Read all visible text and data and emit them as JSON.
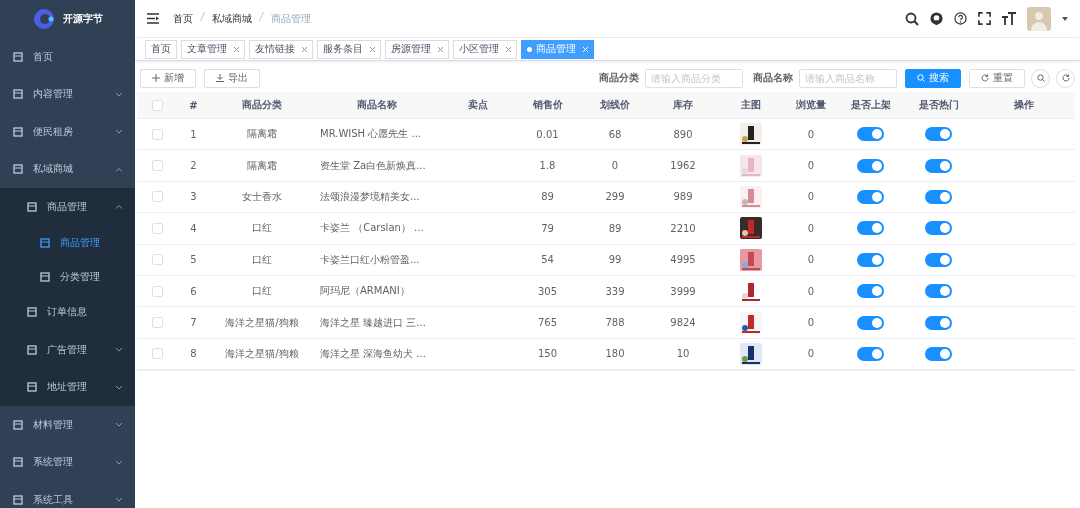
{
  "brand": {
    "name": "开源字节"
  },
  "sidebar": {
    "items": [
      {
        "label": "首页",
        "selected": false
      },
      {
        "label": "内容管理",
        "selected": false,
        "expanded": false
      },
      {
        "label": "便民租房",
        "selected": false,
        "expanded": false
      },
      {
        "label": "私域商城",
        "selected": false,
        "expanded": true,
        "children": [
          {
            "label": "商品管理",
            "selected": false,
            "expanded": true,
            "children": [
              {
                "label": "商品管理",
                "selected": true
              },
              {
                "label": "分类管理",
                "selected": false
              }
            ]
          },
          {
            "label": "订单信息",
            "selected": false
          },
          {
            "label": "广告管理",
            "selected": false,
            "expanded": false
          },
          {
            "label": "地址管理",
            "selected": false,
            "expanded": false
          }
        ]
      },
      {
        "label": "材料管理",
        "selected": false,
        "expanded": false
      },
      {
        "label": "系统管理",
        "selected": false,
        "expanded": false
      },
      {
        "label": "系统工具",
        "selected": false,
        "expanded": false
      }
    ]
  },
  "breadcrumb": [
    {
      "label": "首页",
      "current": false
    },
    {
      "label": "私域商城",
      "current": false
    },
    {
      "label": "商品管理",
      "current": true
    }
  ],
  "tabs": [
    {
      "label": "首页",
      "selected": false,
      "closable": false
    },
    {
      "label": "文章管理",
      "selected": false,
      "closable": true
    },
    {
      "label": "友情链接",
      "selected": false,
      "closable": true
    },
    {
      "label": "服务条目",
      "selected": false,
      "closable": true
    },
    {
      "label": "房源管理",
      "selected": false,
      "closable": true
    },
    {
      "label": "小区管理",
      "selected": false,
      "closable": true
    },
    {
      "label": "商品管理",
      "selected": true,
      "closable": true
    }
  ],
  "toolbar": {
    "buttons": [
      "新增",
      "导出"
    ]
  },
  "search": {
    "fields": [
      {
        "label": "商品分类",
        "placeholder": "请输入商品分类"
      },
      {
        "label": "商品名称",
        "placeholder": "请输入商品名称"
      }
    ],
    "search_button": "搜索",
    "reset_button": "重置"
  },
  "table": {
    "all_checked": false,
    "columns": [
      "#",
      "商品分类",
      "商品名称",
      "卖点",
      "销售价",
      "划线价",
      "库存",
      "主图",
      "浏览量",
      "是否上架",
      "是否热门",
      "操作"
    ],
    "rows": [
      {
        "index": "1",
        "category": "隔离霜",
        "name": "MR.WISH 心愿先生 ...",
        "price": "0.01",
        "list_price": "68",
        "stock": "890",
        "views": "0",
        "listed": true,
        "hot": true,
        "checked": false
      },
      {
        "index": "2",
        "category": "隔离霜",
        "name": "资生堂 Za白色新焕真...",
        "price": "1.8",
        "list_price": "0",
        "stock": "1962",
        "views": "0",
        "listed": true,
        "hot": true,
        "checked": false
      },
      {
        "index": "3",
        "category": "女士香水",
        "name": "法颂浪漫梦境精美女...",
        "price": "89",
        "list_price": "299",
        "stock": "989",
        "views": "0",
        "listed": true,
        "hot": true,
        "checked": false
      },
      {
        "index": "4",
        "category": "口红",
        "name": "卡姿兰 （Carslan） ...",
        "price": "79",
        "list_price": "89",
        "stock": "2210",
        "views": "0",
        "listed": true,
        "hot": true,
        "checked": false
      },
      {
        "index": "5",
        "category": "口红",
        "name": "卡姿兰口红小粉管盈...",
        "price": "54",
        "list_price": "99",
        "stock": "4995",
        "views": "0",
        "listed": true,
        "hot": true,
        "checked": false
      },
      {
        "index": "6",
        "category": "口红",
        "name": "阿玛尼（ARMANI）",
        "price": "305",
        "list_price": "339",
        "stock": "3999",
        "views": "0",
        "listed": true,
        "hot": true,
        "checked": false
      },
      {
        "index": "7",
        "category": "海洋之星猫/狗粮",
        "name": "海洋之星 臻越进口 三...",
        "price": "765",
        "list_price": "788",
        "stock": "9824",
        "views": "0",
        "listed": true,
        "hot": true,
        "checked": false
      },
      {
        "index": "8",
        "category": "海洋之星猫/狗粮",
        "name": "海洋之星 深海鱼幼犬 ...",
        "price": "150",
        "list_price": "180",
        "stock": "10",
        "views": "0",
        "listed": true,
        "hot": true,
        "checked": false
      }
    ]
  }
}
